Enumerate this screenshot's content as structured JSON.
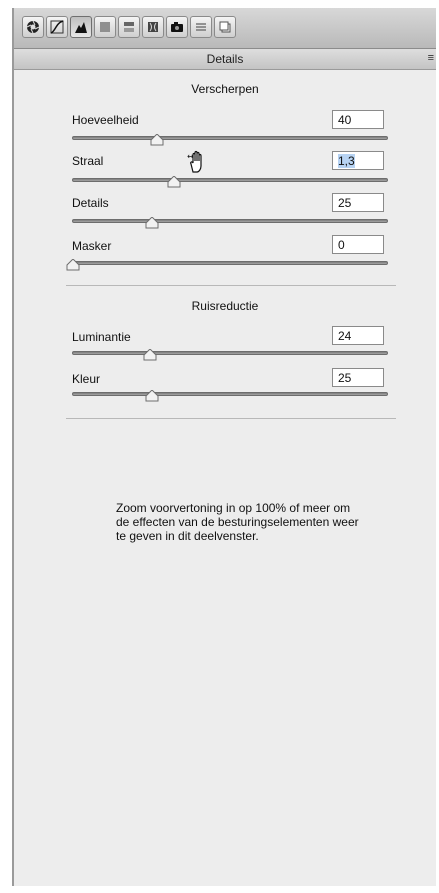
{
  "toolbar": {
    "tools": [
      {
        "icon": "aperture-icon"
      },
      {
        "icon": "tone-curve-icon"
      },
      {
        "icon": "detail-mountain-icon",
        "active": true
      },
      {
        "icon": "hsl-grayscale-icon"
      },
      {
        "icon": "split-toning-icon"
      },
      {
        "icon": "lens-corrections-icon"
      },
      {
        "icon": "camera-calibration-icon"
      },
      {
        "icon": "presets-icon"
      },
      {
        "icon": "snapshots-icon"
      }
    ]
  },
  "panel": {
    "title": "Details",
    "menu_icon": "≡"
  },
  "sharpening": {
    "title": "Verscherpen",
    "controls": [
      {
        "label": "Hoeveelheid",
        "value": "40",
        "level": 0.27
      },
      {
        "label": "Straal",
        "value": "1,3",
        "level": 0.33,
        "selected": true
      },
      {
        "label": "Details",
        "value": "25",
        "level": 0.25
      },
      {
        "label": "Masker",
        "value": "0",
        "level": 0.0
      }
    ]
  },
  "noise": {
    "title": "Ruisreductie",
    "controls": [
      {
        "label": "Luminantie",
        "value": "24",
        "level": 0.24
      },
      {
        "label": "Kleur",
        "value": "25",
        "level": 0.25
      }
    ]
  },
  "info_text": "Zoom voorvertoning in op 100% of meer om de effecten van de besturingselementen weer te geven in dit deelvenster."
}
